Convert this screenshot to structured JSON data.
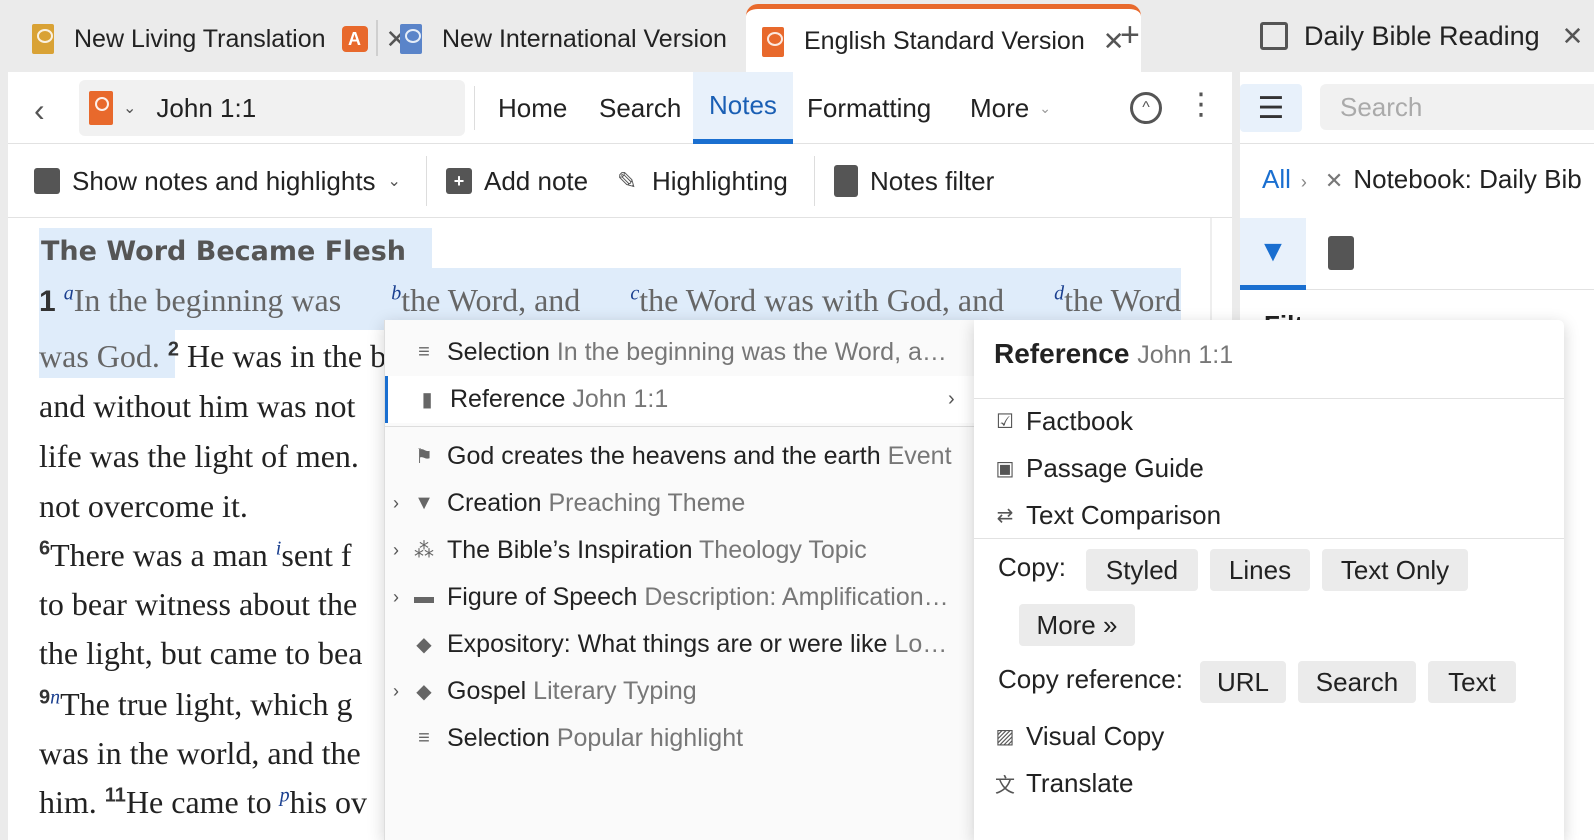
{
  "tabs": [
    {
      "label": "New Living Translation",
      "badge": "A",
      "color": "#d9a235"
    },
    {
      "label": "New International Version",
      "color": "#5a84c9"
    },
    {
      "label": "English Standard Version",
      "color": "#e8692c"
    }
  ],
  "side_tab": {
    "label": "Daily Bible Reading"
  },
  "toolbar": {
    "reference": "John 1:1",
    "menu": [
      "Home",
      "Search",
      "Notes",
      "Formatting",
      "More"
    ],
    "active_menu": "Notes"
  },
  "notes_toolbar": {
    "show_notes": "Show notes and highlights",
    "add_note": "Add note",
    "highlighting": "Highlighting",
    "notes_filter": "Notes filter"
  },
  "passage": {
    "heading": "The Word Became Flesh",
    "lines": [
      {
        "verse": "1",
        "fa": "a",
        "t1": "In the beginning was ",
        "fb": "b",
        "t2": "the Word, and ",
        "fc": "c",
        "t3": "the Word was with God, and ",
        "fd": "d",
        "t4": "the Word"
      },
      {
        "t1": "was God. ",
        "v2": "2",
        "t2": "He was in the b"
      },
      {
        "t1": "and without him was not"
      },
      {
        "t1": "life was the light of men."
      },
      {
        "t1": "not overcome it."
      },
      {
        "v6": "6",
        "t1": "There was a man ",
        "fi": "i",
        "t2": "sent f"
      },
      {
        "t1": "to bear witness about the"
      },
      {
        "t1": "the light, but came to bea"
      },
      {
        "v9": "9",
        "fn": "n",
        "t1": "The true light, which g"
      },
      {
        "t1": "was in the world, and the"
      },
      {
        "t1": "him. ",
        "v11": "11",
        "t2": "He came to ",
        "fp": "p",
        "t3": "his ov"
      }
    ]
  },
  "sidebar": {
    "search_placeholder": "Search",
    "crumb_all": "All",
    "crumb_notebook": "Notebook: Daily Bib",
    "cut_heading": "Filt"
  },
  "context_menu": {
    "items": [
      {
        "label": "Selection",
        "sub": "In the beginning was the Word, a…",
        "icon": "lines-icon"
      },
      {
        "label": "Reference",
        "sub": "John 1:1",
        "icon": "bookmark-icon"
      },
      {
        "label": "God creates the heavens and the earth",
        "sub": "Event",
        "icon": "flag-icon"
      },
      {
        "label": "Creation",
        "sub": "Preaching Theme",
        "icon": "podium-icon"
      },
      {
        "label": "The Bible’s Inspiration",
        "sub": "Theology Topic",
        "icon": "hierarchy-icon"
      },
      {
        "label": "Figure of Speech",
        "sub": "Description: Amplification…",
        "icon": "tag-icon"
      },
      {
        "label": "Expository: What things are or were like",
        "sub": "Lo…",
        "icon": "diamond-icon"
      },
      {
        "label": "Gospel",
        "sub": "Literary Typing",
        "icon": "diamond-icon"
      },
      {
        "label": "Selection",
        "sub": "Popular highlight",
        "icon": "lines-icon"
      }
    ]
  },
  "reference_panel": {
    "title": "Reference",
    "title_sub": "John 1:1",
    "guides": [
      "Factbook",
      "Passage Guide",
      "Text Comparison"
    ],
    "copy_label": "Copy:",
    "copy_options": [
      "Styled",
      "Lines",
      "Text Only",
      "More »"
    ],
    "copy_ref_label": "Copy reference:",
    "copy_ref_options": [
      "URL",
      "Search",
      "Text"
    ],
    "actions": [
      "Visual Copy",
      "Translate"
    ]
  },
  "colors": {
    "accent": "#1a6fd0",
    "esv_orange": "#e8692c",
    "highlight": "#dfecfa"
  }
}
